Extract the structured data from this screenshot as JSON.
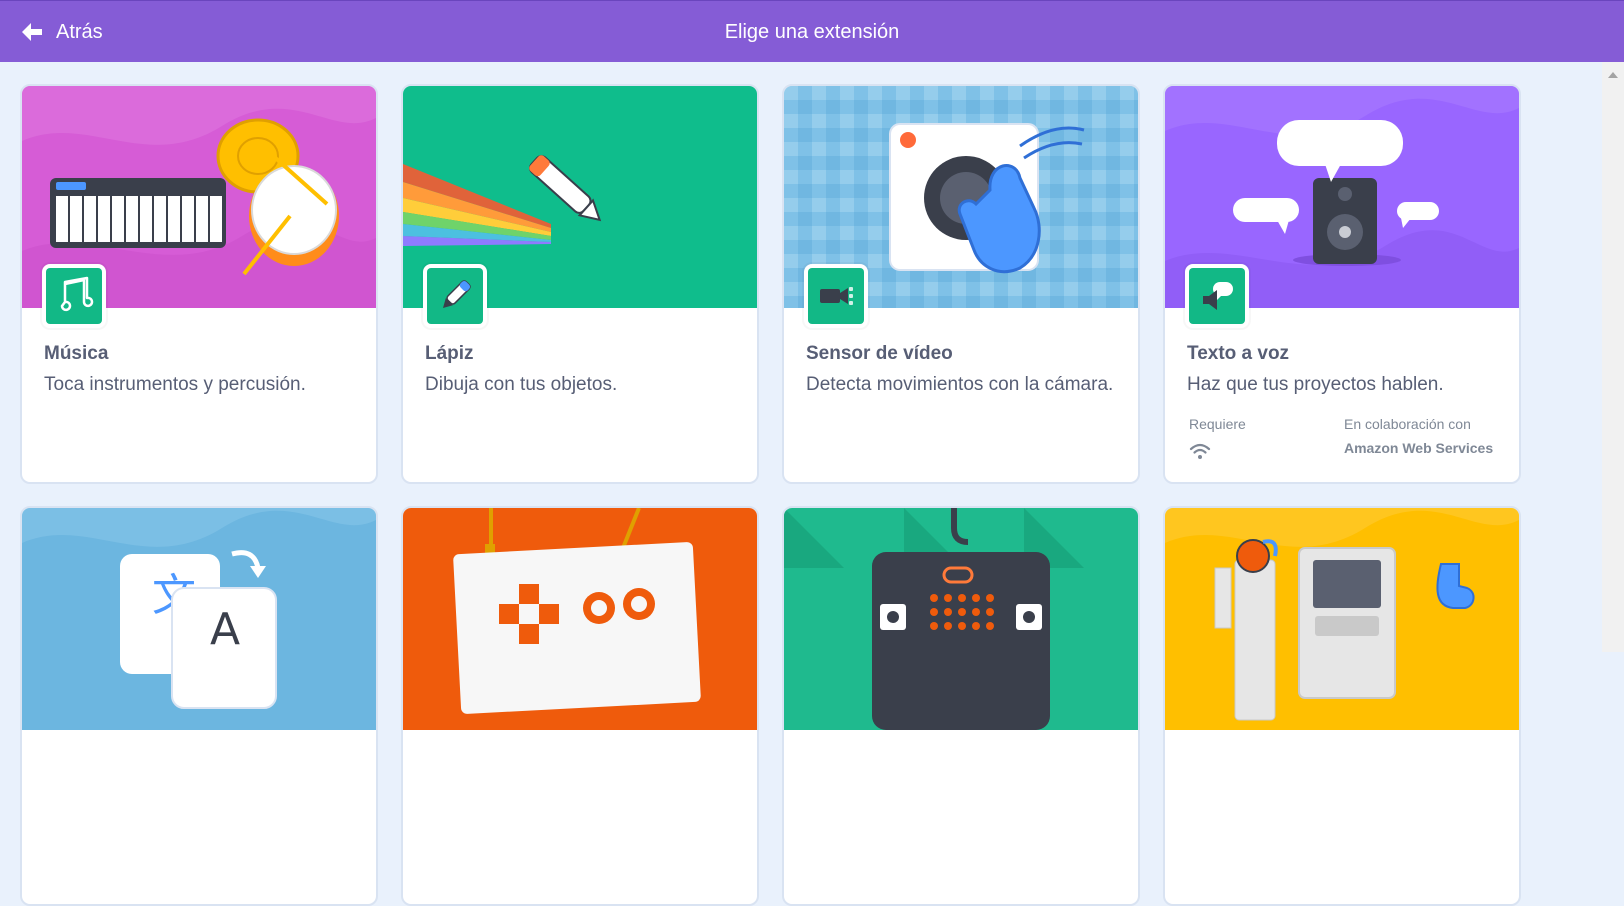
{
  "header": {
    "back_label": "Atrás",
    "title": "Elige una extensión",
    "bg_color": "#855cd6"
  },
  "extensions": [
    {
      "name": "Música",
      "description": "Toca instrumentos y percusión.",
      "banner_color": "#d65cd6",
      "icon": "music-notes-icon"
    },
    {
      "name": "Lápiz",
      "description": "Dibuja con tus objetos.",
      "banner_color": "#0fbd8c",
      "icon": "pen-icon"
    },
    {
      "name": "Sensor de vídeo",
      "description": "Detecta movimientos con la cámara.",
      "banner_color": "#7fc1e7",
      "icon": "video-camera-icon"
    },
    {
      "name": "Texto a voz",
      "description": "Haz que tus proyectos hablen.",
      "banner_color": "#9966ff",
      "icon": "speech-icon",
      "requires_label": "Requiere",
      "requires_icon": "wifi-icon",
      "collab_label": "En colaboración con",
      "collab_value": "Amazon Web Services"
    },
    {
      "name": "",
      "description": "",
      "banner_color": "#6cb6e0",
      "icon": "translate-icon"
    },
    {
      "name": "",
      "description": "",
      "banner_color": "#ef5b0c",
      "icon": "makey-icon"
    },
    {
      "name": "",
      "description": "",
      "banner_color": "#1fba8e",
      "icon": "microbit-icon"
    },
    {
      "name": "",
      "description": "",
      "banner_color": "#ffbf00",
      "icon": "lego-robot-icon"
    }
  ]
}
